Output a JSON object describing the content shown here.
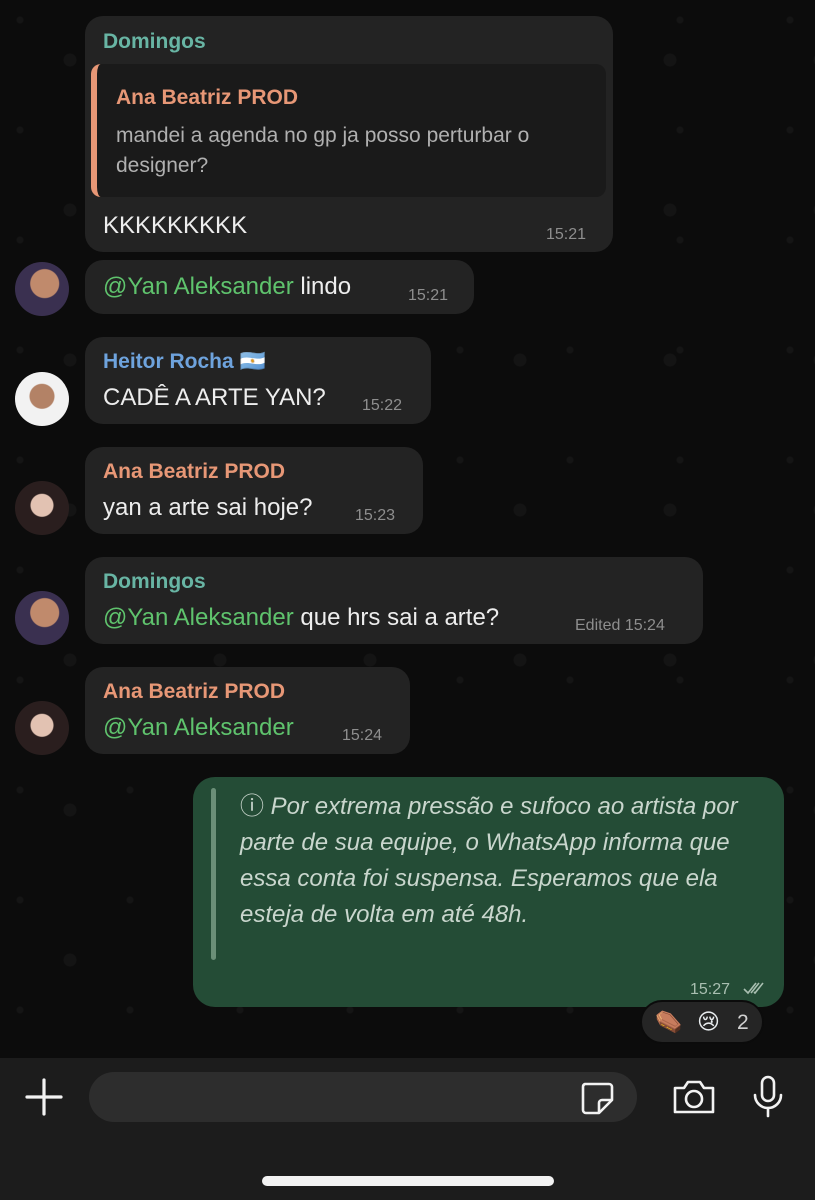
{
  "colors": {
    "domingos": "#68b5a4",
    "ana": "#e79776",
    "heitor": "#6ea3dd",
    "mention": "#5fc36d",
    "outgoing_bubble": "#244c36"
  },
  "messages": [
    {
      "sender": "Domingos",
      "reply": {
        "sender": "Ana Beatriz PROD",
        "line1": "mandei a agenda no gp ja posso perturbar o",
        "line2": "designer?"
      },
      "text": "KKKKKKKKK",
      "time": "15:21"
    },
    {
      "mention": "@Yan Aleksander",
      "text": " lindo",
      "time": "15:21"
    },
    {
      "sender": "Heitor Rocha",
      "sender_flag": "🇦🇷",
      "text": "CADÊ A ARTE YAN?",
      "time": "15:22"
    },
    {
      "sender": "Ana Beatriz PROD",
      "text": "yan a arte sai hoje?",
      "time": "15:23"
    },
    {
      "sender": "Domingos",
      "mention": "@Yan Aleksander",
      "text": " que hrs sai a arte?",
      "time": "Edited 15:24"
    },
    {
      "sender": "Ana Beatriz PROD",
      "mention": "@Yan Aleksander",
      "time": "15:24"
    }
  ],
  "outgoing": {
    "info_icon": "ⓘ",
    "text": "Por extrema pressão e sufoco ao artista por parte de sua equipe, o WhatsApp informa que essa conta foi suspensa. Esperamos que ela esteja de volta em até 48h.",
    "time": "15:27",
    "status": "read-double-check-icon",
    "reactions": {
      "emoji1": "⚰️",
      "emoji2": "😢",
      "count": "2"
    }
  },
  "input_bar": {
    "placeholder": "",
    "icons": [
      "plus-icon",
      "sticker-icon",
      "camera-icon",
      "microphone-icon"
    ]
  }
}
